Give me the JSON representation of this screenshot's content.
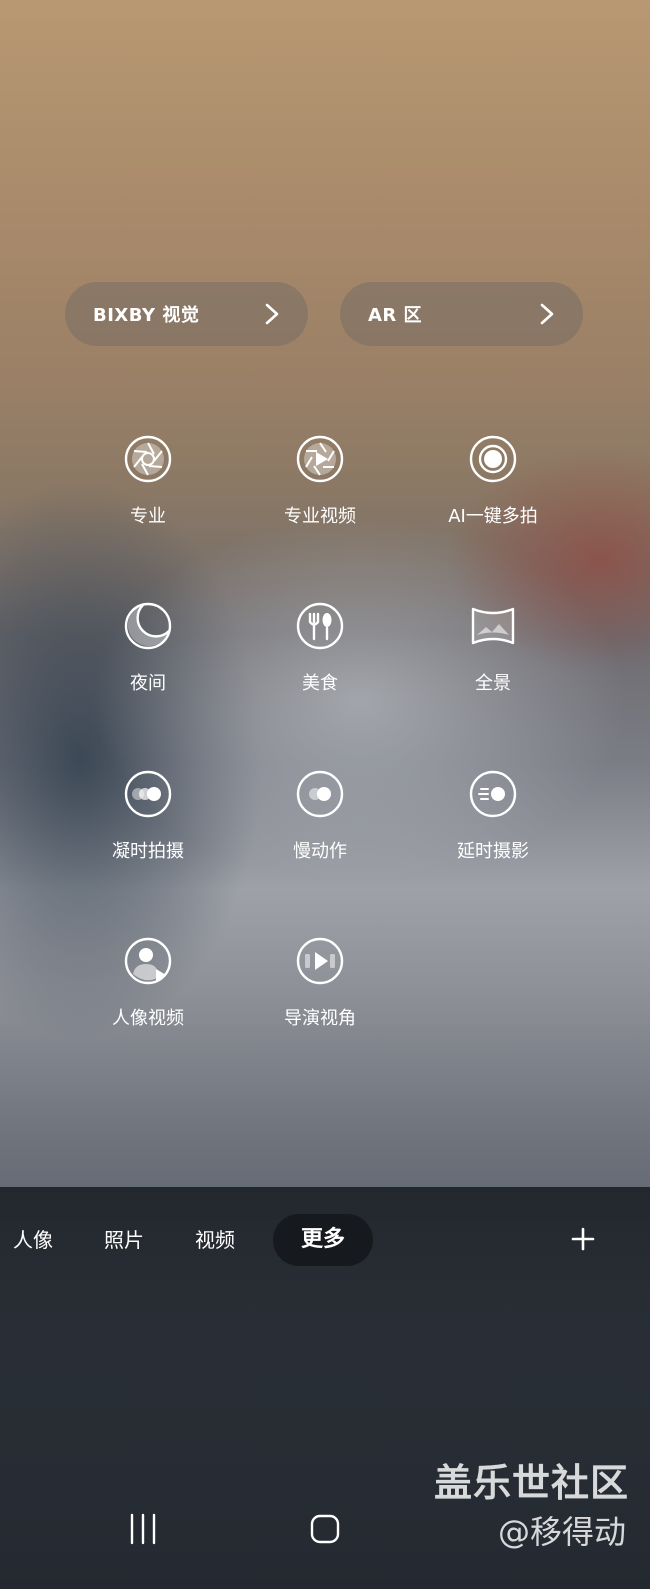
{
  "shortcuts": {
    "bixby_label": "BIXBY 视觉",
    "ar_label": "AR 区"
  },
  "modes": [
    {
      "label": "专业",
      "icon": "aperture-icon"
    },
    {
      "label": "专业视频",
      "icon": "aperture-play-icon"
    },
    {
      "label": "AI一键多拍",
      "icon": "single-take-icon"
    },
    {
      "label": "夜间",
      "icon": "moon-icon"
    },
    {
      "label": "美食",
      "icon": "fork-spoon-icon"
    },
    {
      "label": "全景",
      "icon": "panorama-icon"
    },
    {
      "label": "凝时拍摄",
      "icon": "hyperlapse-icon"
    },
    {
      "label": "慢动作",
      "icon": "slow-motion-icon"
    },
    {
      "label": "延时摄影",
      "icon": "super-slow-motion-icon"
    },
    {
      "label": "人像视频",
      "icon": "portrait-video-icon"
    },
    {
      "label": "导演视角",
      "icon": "directors-view-icon"
    }
  ],
  "tabs": {
    "portrait": "人像",
    "photo": "照片",
    "video": "视频",
    "more": "更多"
  },
  "watermark": {
    "line1": "盖乐世社区",
    "line2": "@移得动"
  },
  "colors": {
    "pill_bg": "#7a6f66",
    "active_tab_bg": "#16181c",
    "text": "#ffffff"
  }
}
